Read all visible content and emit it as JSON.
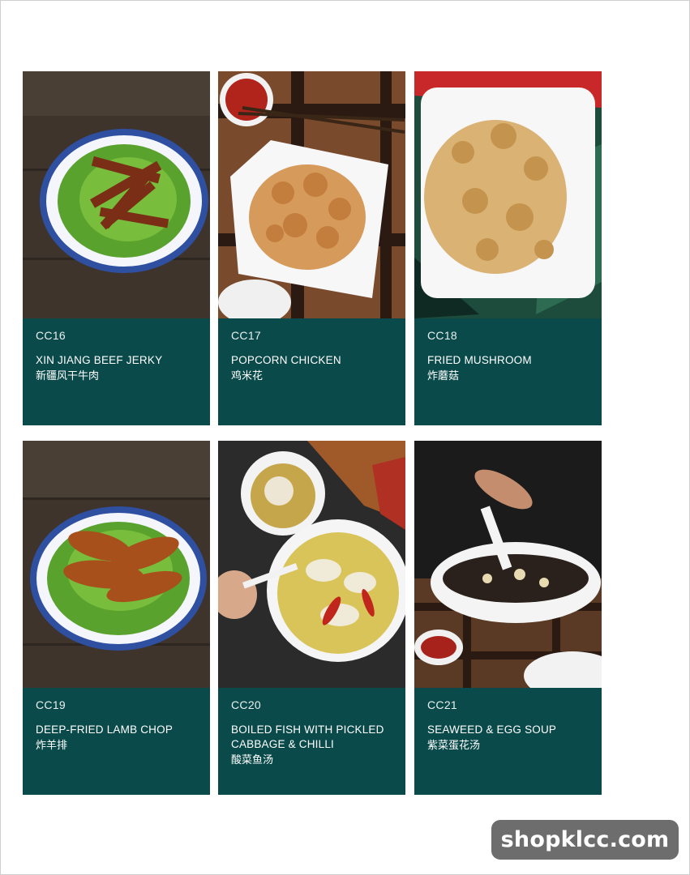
{
  "menu_items": [
    {
      "code": "CC16",
      "name_en": "XIN JIANG BEEF JERKY",
      "name_cn": "新疆风干牛肉"
    },
    {
      "code": "CC17",
      "name_en": "POPCORN CHICKEN",
      "name_cn": "鸡米花"
    },
    {
      "code": "CC18",
      "name_en": "FRIED MUSHROOM",
      "name_cn": "炸蘑菇"
    },
    {
      "code": "CC19",
      "name_en": "DEEP-FRIED LAMB CHOP",
      "name_cn": "炸羊排"
    },
    {
      "code": "CC20",
      "name_en": "BOILED FISH WITH PICKLED CABBAGE & CHILLI",
      "name_cn": "酸菜鱼汤"
    },
    {
      "code": "CC21",
      "name_en": "SEAWEED & EGG SOUP",
      "name_cn": "紫菜蛋花汤"
    }
  ],
  "watermark": "shopklcc.com",
  "colors": {
    "card_bg": "#0b4a4a",
    "watermark_bg": "#6d6d6d"
  }
}
